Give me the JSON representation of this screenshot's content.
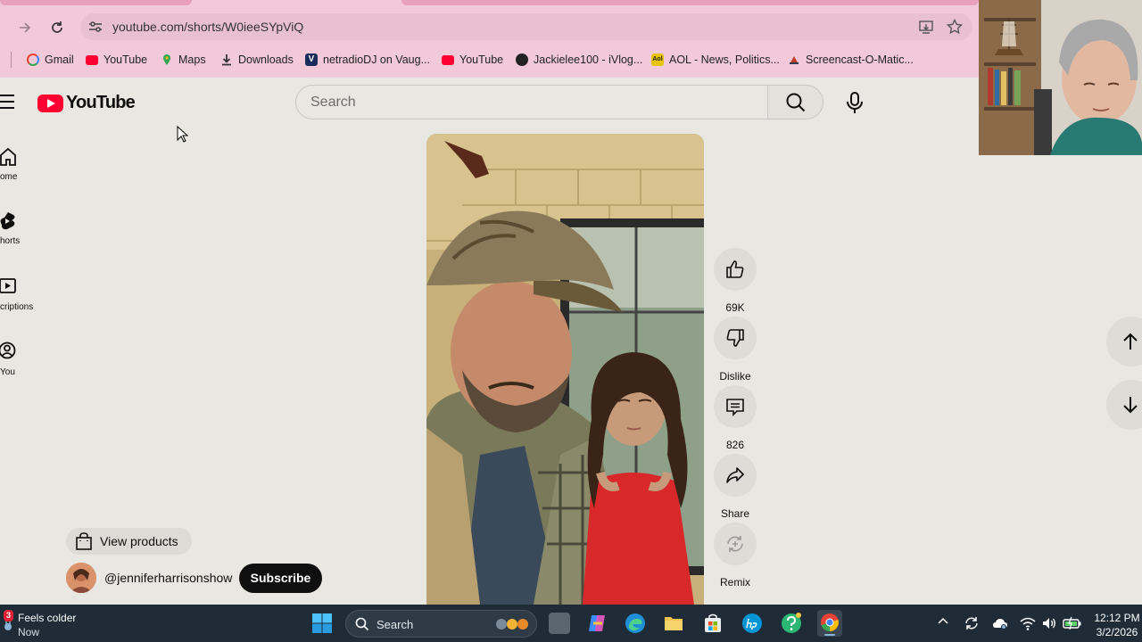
{
  "browser": {
    "url": "youtube.com/shorts/W0ieeSYpViQ",
    "bookmarks": [
      {
        "label": "Gmail",
        "icon": "gmail-icon",
        "color": "#ea4335"
      },
      {
        "label": "YouTube",
        "icon": "youtube-icon",
        "color": "#ff0033"
      },
      {
        "label": "Maps",
        "icon": "maps-icon",
        "color": "#34a853"
      },
      {
        "label": "Downloads",
        "icon": "download-icon",
        "color": "#333333"
      },
      {
        "label": "netradioDJ on Vaug...",
        "icon": "vaughn-icon",
        "color": "#1a2d5a"
      },
      {
        "label": "YouTube",
        "icon": "youtube-icon",
        "color": "#ff0033"
      },
      {
        "label": "Jackielee100 - iVlog...",
        "icon": "jackielee-icon",
        "color": "#222222"
      },
      {
        "label": "AOL - News, Politics...",
        "icon": "aol-icon",
        "color": "#e6c400"
      },
      {
        "label": "Screencast-O-Matic...",
        "icon": "screencast-icon",
        "color": "#c0392b"
      }
    ]
  },
  "youtube": {
    "logo_text": "YouTube",
    "search_placeholder": "Search",
    "nav": [
      {
        "label": "ome",
        "icon": "home-icon"
      },
      {
        "label": "horts",
        "icon": "shorts-icon"
      },
      {
        "label": "criptions",
        "icon": "subscriptions-icon"
      },
      {
        "label": "You",
        "icon": "you-icon"
      }
    ],
    "actions": {
      "like": "69K",
      "dislike": "Dislike",
      "comments": "826",
      "share": "Share",
      "remix": "Remix"
    },
    "view_products": "View products",
    "channel": "@jenniferharrisonshow",
    "subscribe": "Subscribe",
    "brand_color": "#ff0033"
  },
  "taskbar": {
    "weather_badge": "3",
    "weather_title": "Feels colder",
    "weather_sub": "Now",
    "search_placeholder": "Search",
    "time": "12:12 PM",
    "date": "3/2/2026"
  }
}
